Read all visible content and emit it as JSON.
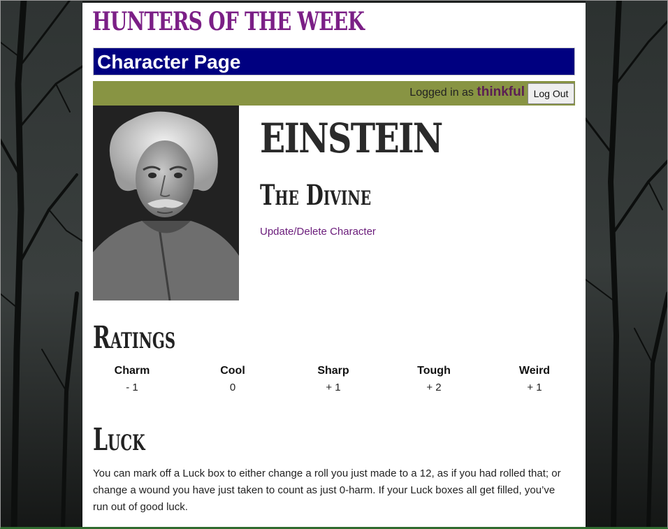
{
  "site": {
    "title": "Hunters of the Week"
  },
  "header": {
    "title": "Character Page"
  },
  "session": {
    "logged_in_prefix": "Logged in as",
    "username": "thinkful",
    "logout_label": "Log Out"
  },
  "character": {
    "name": "Einstein",
    "playbook": "The Divine",
    "update_link": "Update/Delete Character"
  },
  "ratings": {
    "title": "Ratings",
    "items": [
      {
        "label": "Charm",
        "value": "- 1"
      },
      {
        "label": "Cool",
        "value": "0"
      },
      {
        "label": "Sharp",
        "value": "+ 1"
      },
      {
        "label": "Tough",
        "value": "+ 2"
      },
      {
        "label": "Weird",
        "value": "+ 1"
      }
    ]
  },
  "luck": {
    "title": "Luck",
    "text": "You can mark off a Luck box to either change a roll you just made to a 12, as if you had rolled that; or change a wound you have just taken to count as just 0-harm. If your Luck boxes all get filled, you’ve run out of good luck."
  },
  "colors": {
    "site_title": "#7b1f86",
    "header_bg": "#000080",
    "status_bar_bg": "#889443",
    "username": "#5b1f53",
    "link": "#6a1b7a"
  }
}
